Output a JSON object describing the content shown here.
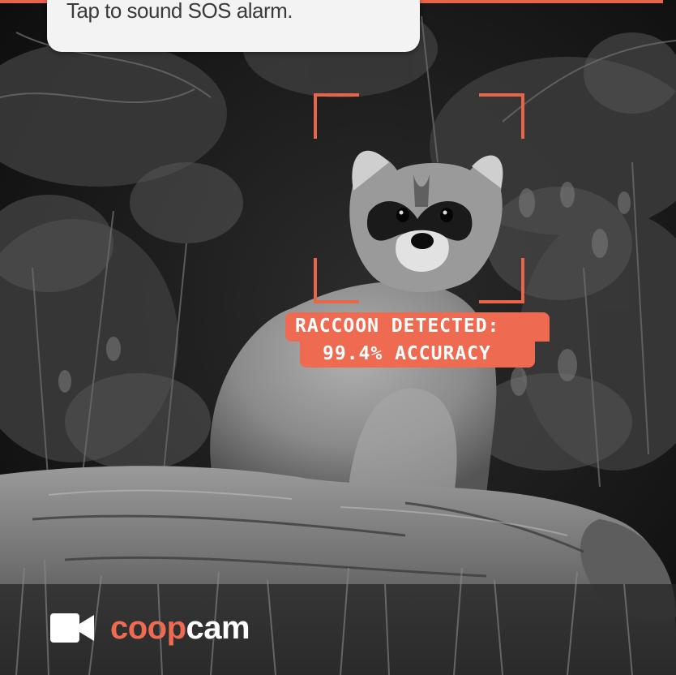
{
  "notification": {
    "message": "Tap to sound SOS alarm."
  },
  "detection": {
    "line1": "RACCOON DETECTED:",
    "line2": "99.4% ACCURACY",
    "accent_color": "#e8654a"
  },
  "brand": {
    "name_part1": "coop",
    "name_part2": "cam",
    "icon": "video-camera-icon",
    "accent_color": "#ee6a50"
  }
}
